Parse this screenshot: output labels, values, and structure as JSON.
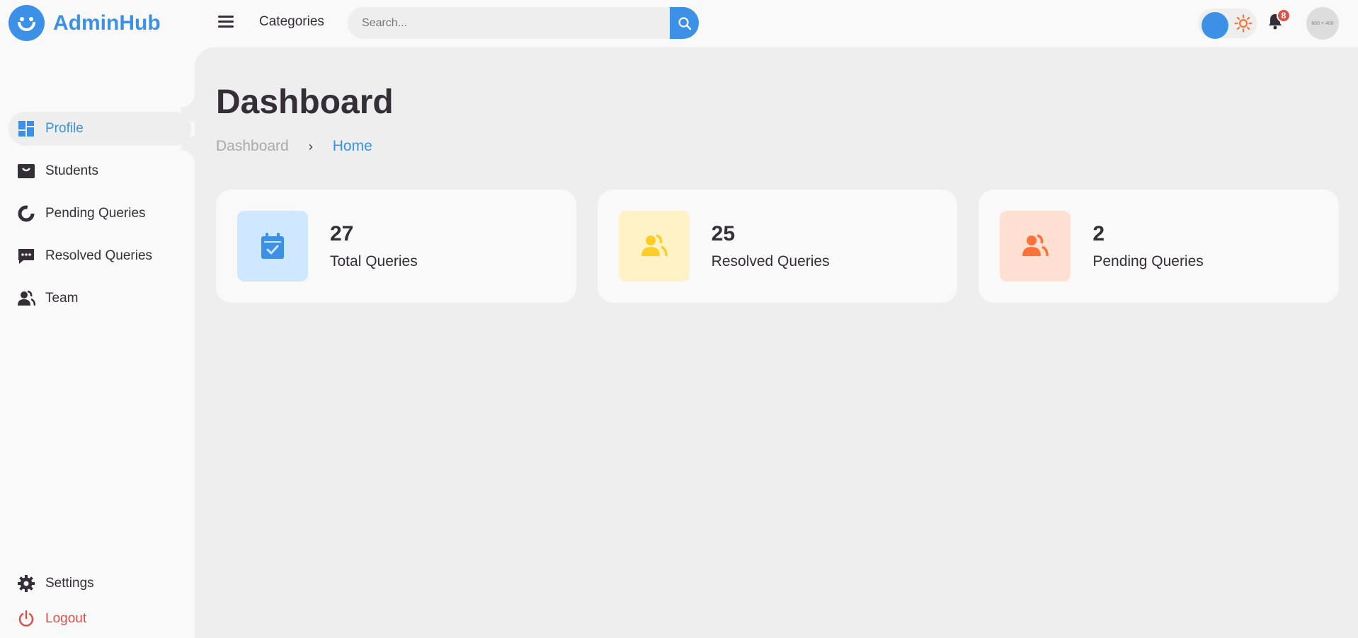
{
  "brand": {
    "name": "AdminHub"
  },
  "sidebar": {
    "items": [
      {
        "label": "Profile",
        "icon": "dashboard-icon",
        "active": true
      },
      {
        "label": "Students",
        "icon": "shopping-bag-icon"
      },
      {
        "label": "Pending Queries",
        "icon": "doughnut-chart-icon"
      },
      {
        "label": "Resolved Queries",
        "icon": "message-dots-icon"
      },
      {
        "label": "Team",
        "icon": "group-icon"
      }
    ],
    "bottom": [
      {
        "label": "Settings",
        "icon": "gear-icon"
      },
      {
        "label": "Logout",
        "icon": "power-icon"
      }
    ]
  },
  "topnav": {
    "nav_link": "Categories",
    "search": {
      "placeholder": "Search...",
      "value": ""
    },
    "notifications": {
      "count": "8"
    },
    "avatar_text": "600 × 400"
  },
  "main": {
    "title": "Dashboard",
    "breadcrumb": [
      "Dashboard",
      "Home"
    ],
    "boxes": [
      {
        "value": "27",
        "label": "Total Queries",
        "icon": "calendar-check-icon",
        "bg": "#cfe8ff",
        "color": "#3c91e6"
      },
      {
        "value": "25",
        "label": "Resolved Queries",
        "icon": "group-icon",
        "bg": "#fff2c6",
        "color": "#ffce26"
      },
      {
        "value": "2",
        "label": "Pending Queries",
        "icon": "group-icon",
        "bg": "#ffe0d3",
        "color": "#fd7238"
      }
    ]
  },
  "colors": {
    "accent": "#3c91e6",
    "danger": "#db504a",
    "dark": "#342e37"
  }
}
